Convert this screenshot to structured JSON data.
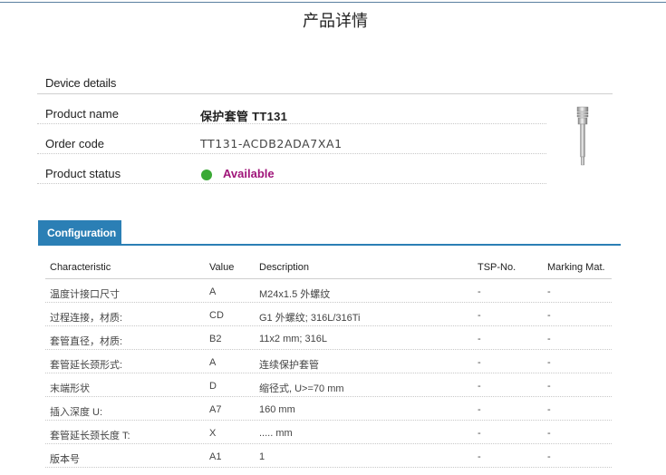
{
  "page_title": "产品详情",
  "device_details": {
    "heading": "Device details",
    "product_name_label": "Product name",
    "product_name_value": "保护套管 TT131",
    "order_code_label": "Order code",
    "order_code_value": "TT131-ACDB2ADA7XA1",
    "product_status_label": "Product status",
    "product_status_value": "Available",
    "status_color": "#3aa935"
  },
  "configuration": {
    "tab_label": "Configuration",
    "headers": [
      "Characteristic",
      "Value",
      "Description",
      "TSP-No.",
      "Marking Mat."
    ],
    "rows": [
      [
        "温度计接口尺寸",
        "A",
        "M24x1.5 外螺纹",
        "-",
        "-"
      ],
      [
        "过程连接，材质:",
        "CD",
        "G1 外螺纹; 316L/316Ti",
        "-",
        "-"
      ],
      [
        "套管直径，材质:",
        "B2",
        "11x2 mm; 316L",
        "-",
        "-"
      ],
      [
        "套管延长颈形式:",
        "A",
        "连续保护套管",
        "-",
        "-"
      ],
      [
        "末端形状",
        "D",
        "缩径式, U>=70 mm",
        "-",
        "-"
      ],
      [
        "插入深度 U:",
        "A7",
        "160 mm",
        "-",
        "-"
      ],
      [
        "套管延长颈长度 T:",
        "X",
        "..... mm",
        "-",
        "-"
      ],
      [
        "版本号",
        "A1",
        "1",
        "-",
        "-"
      ]
    ]
  },
  "colors": {
    "accent": "#2b7fb5",
    "status_text": "#a0157a"
  }
}
